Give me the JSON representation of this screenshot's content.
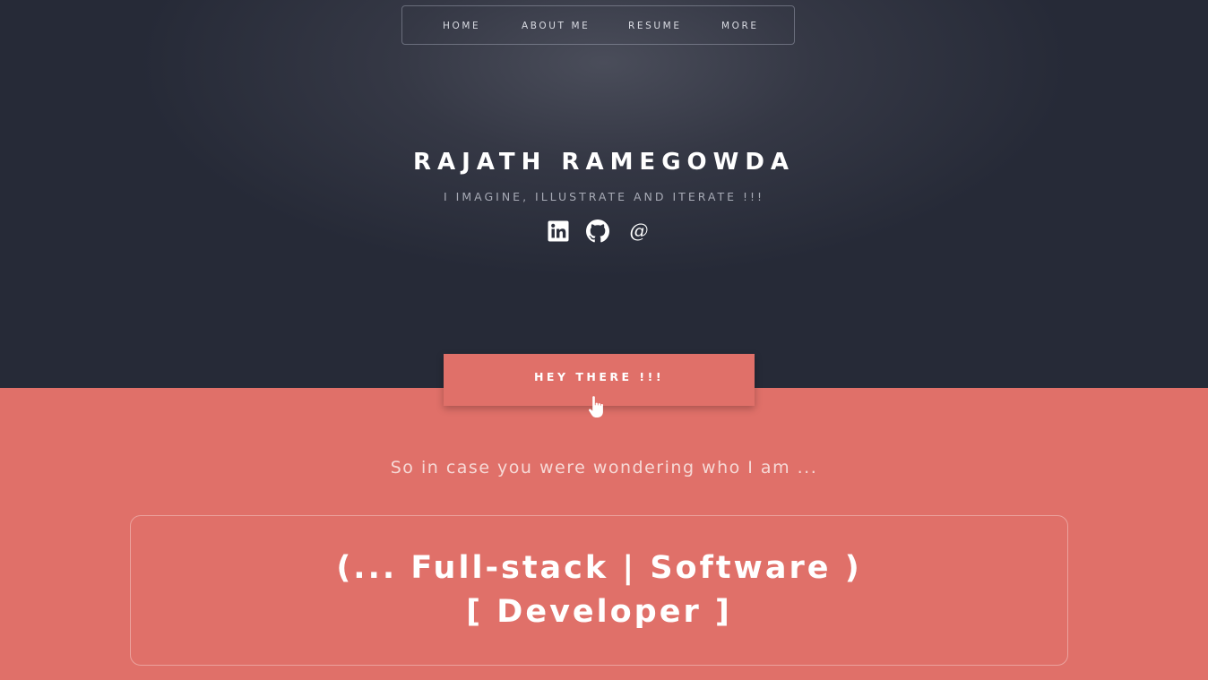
{
  "nav": {
    "items": [
      {
        "label": "HOME"
      },
      {
        "label": "ABOUT ME"
      },
      {
        "label": "RESUME"
      },
      {
        "label": "MORE"
      }
    ]
  },
  "hero": {
    "name": "RAJATH RAMEGOWDA",
    "tagline": "I IMAGINE, ILLUSTRATE AND ITERATE !!!",
    "social": [
      {
        "icon": "linkedin-icon"
      },
      {
        "icon": "github-icon"
      },
      {
        "icon": "at-sign-icon",
        "glyph": "@"
      }
    ]
  },
  "about": {
    "tab_title": "HEY THERE !!!",
    "tab_icon": "pointing-hand-icon",
    "intro": "So in case you were wondering who I am ...",
    "role_line1": "(... Full-stack | Software )",
    "role_line2": "[ Developer ]"
  },
  "colors": {
    "hero_background": "#2b2f3c",
    "accent": "#e07069",
    "text_light": "#ffffff"
  }
}
